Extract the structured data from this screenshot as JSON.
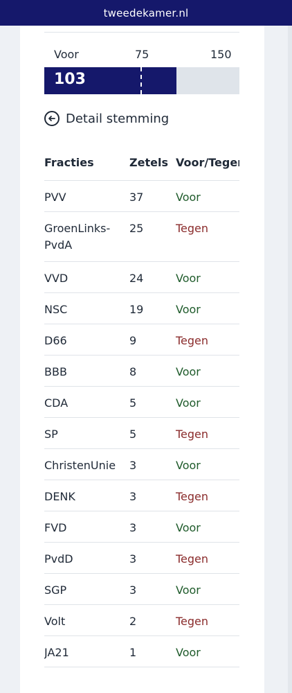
{
  "site": {
    "domain": "tweedekamer.nl"
  },
  "scale": {
    "label": "Voor",
    "mid": "75",
    "max": "150"
  },
  "result": {
    "voor": "103",
    "voor_count": 103,
    "threshold": 75,
    "total": 150
  },
  "detail": {
    "label": "Detail stemming",
    "icon": "arrow-left-circle-icon"
  },
  "table": {
    "headers": {
      "party": "Fracties",
      "seats": "Zetels",
      "vote": "Voor/Tegen"
    },
    "rows": [
      {
        "party": "PVV",
        "seats": "37",
        "vote": "Voor"
      },
      {
        "party": "GroenLinks-PvdA",
        "seats": "25",
        "vote": "Tegen"
      },
      {
        "party": "VVD",
        "seats": "24",
        "vote": "Voor"
      },
      {
        "party": "NSC",
        "seats": "19",
        "vote": "Voor"
      },
      {
        "party": "D66",
        "seats": "9",
        "vote": "Tegen"
      },
      {
        "party": "BBB",
        "seats": "8",
        "vote": "Voor"
      },
      {
        "party": "CDA",
        "seats": "5",
        "vote": "Voor"
      },
      {
        "party": "SP",
        "seats": "5",
        "vote": "Tegen"
      },
      {
        "party": "ChristenUnie",
        "seats": "3",
        "vote": "Voor"
      },
      {
        "party": "DENK",
        "seats": "3",
        "vote": "Tegen"
      },
      {
        "party": "FVD",
        "seats": "3",
        "vote": "Voor"
      },
      {
        "party": "PvdD",
        "seats": "3",
        "vote": "Tegen"
      },
      {
        "party": "SGP",
        "seats": "3",
        "vote": "Voor"
      },
      {
        "party": "Volt",
        "seats": "2",
        "vote": "Tegen"
      },
      {
        "party": "JA21",
        "seats": "1",
        "vote": "Voor"
      }
    ]
  },
  "colors": {
    "brand": "#15186b",
    "voor": "#1f5b2b",
    "tegen": "#8a2b2b",
    "bar_bg": "#dfe4ea"
  }
}
